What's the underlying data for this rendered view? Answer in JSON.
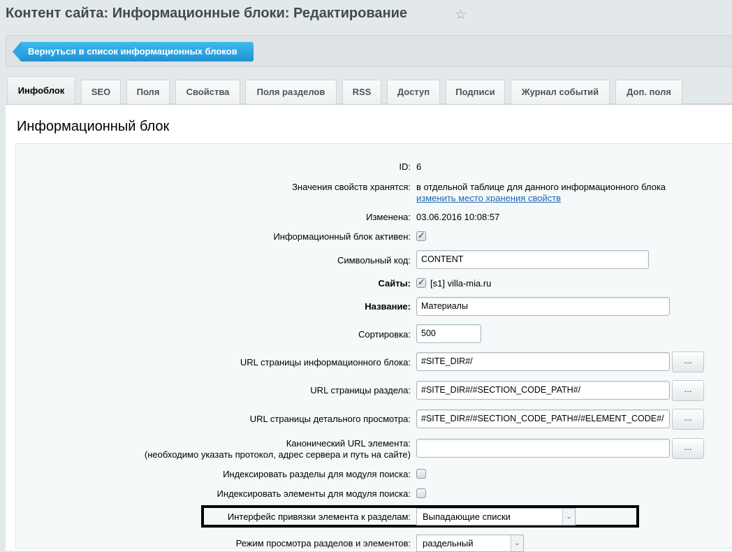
{
  "header": {
    "title": "Контент сайта: Информационные блоки: Редактирование",
    "back_label": "Вернуться в список информационных блоков"
  },
  "tabs": [
    "Инфоблок",
    "SEO",
    "Поля",
    "Свойства",
    "Поля разделов",
    "RSS",
    "Доступ",
    "Подписи",
    "Журнал событий",
    "Доп. поля"
  ],
  "section_title": "Информационный блок",
  "form": {
    "id": {
      "label": "ID:",
      "value": "6"
    },
    "storage": {
      "label": "Значения свойств хранятся:",
      "value": "в отдельной таблице для данного информационного блока",
      "link": "изменить место хранения свойств"
    },
    "changed": {
      "label": "Изменена:",
      "value": "03.06.2016 10:08:57"
    },
    "active": {
      "label": "Информационный блок активен:",
      "checked": true
    },
    "code": {
      "label": "Символьный код:",
      "value": "CONTENT"
    },
    "sites": {
      "label": "Сайты:",
      "value": "[s1] villa-mia.ru",
      "checked": true
    },
    "name": {
      "label": "Название:",
      "value": "Материалы"
    },
    "sort": {
      "label": "Сортировка:",
      "value": "500"
    },
    "list_url": {
      "label": "URL страницы информационного блока:",
      "value": "#SITE_DIR#/",
      "button": "..."
    },
    "section_url": {
      "label": "URL страницы раздела:",
      "value": "#SITE_DIR#/#SECTION_CODE_PATH#/",
      "button": "..."
    },
    "detail_url": {
      "label": "URL страницы детального просмотра:",
      "value": "#SITE_DIR#/#SECTION_CODE_PATH#/#ELEMENT_CODE#/",
      "button": "..."
    },
    "canonical": {
      "label": "Канонический URL элемента:",
      "note": "(необходимо указать протокол, адрес сервера и путь на сайте)",
      "value": "",
      "button": "..."
    },
    "index_sections": {
      "label": "Индексировать разделы для модуля поиска:",
      "checked": false
    },
    "index_elements": {
      "label": "Индексировать элементы для модуля поиска:",
      "checked": false
    },
    "section_ui": {
      "label": "Интерфейс привязки элемента к разделам:",
      "value": "Выпадающие списки"
    },
    "view_mode": {
      "label": "Режим просмотра разделов и элементов:",
      "value": "раздельный"
    }
  }
}
